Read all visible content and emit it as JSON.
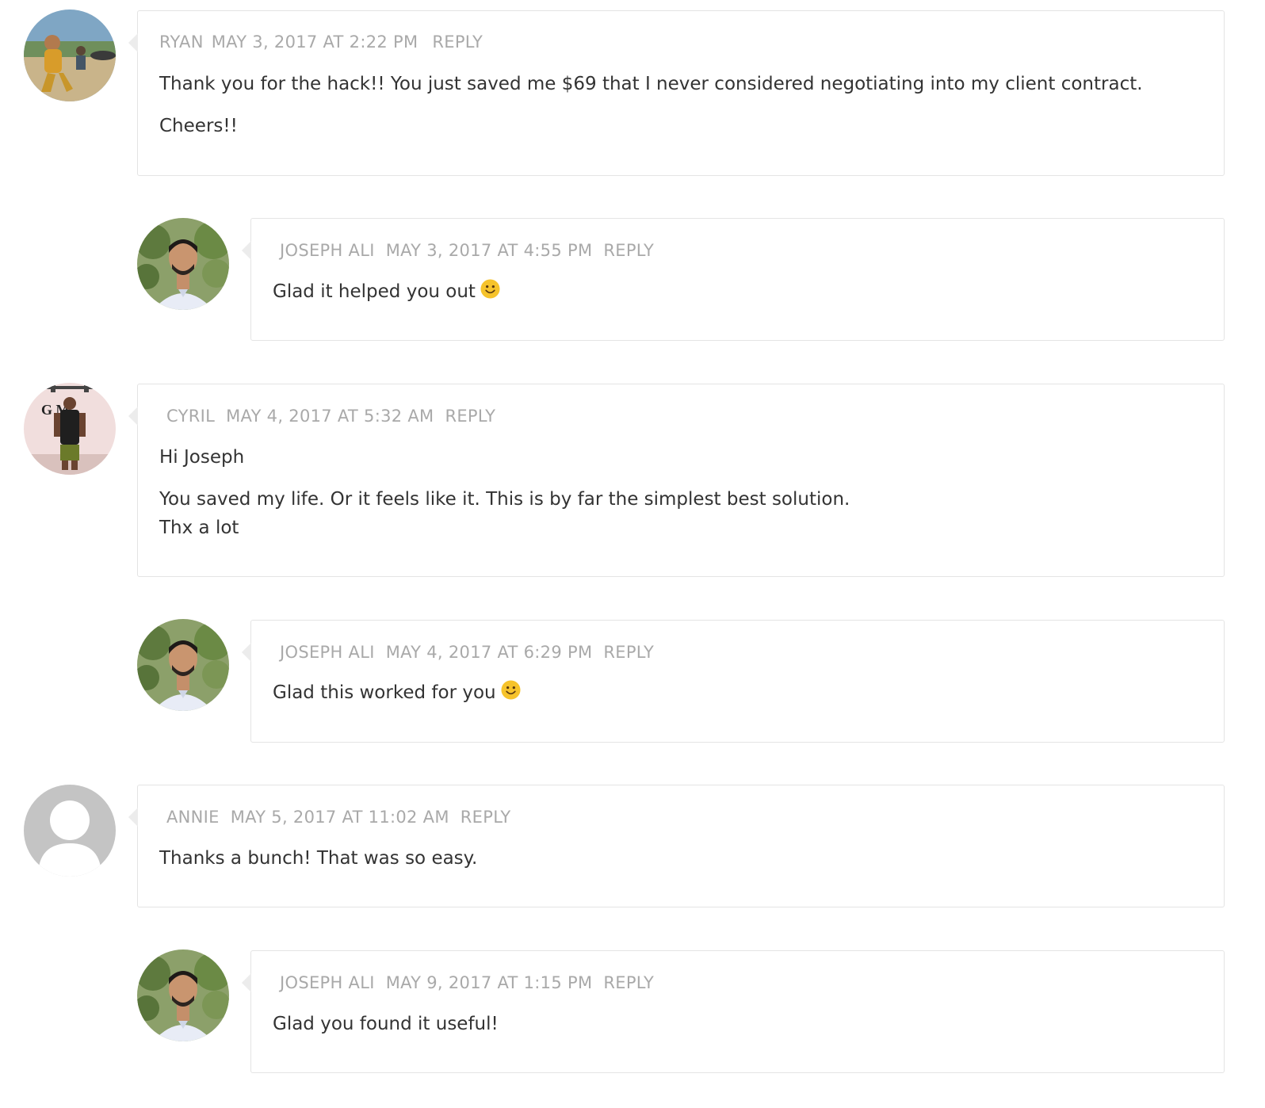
{
  "comments": [
    {
      "author": "RYAN",
      "date": "MAY 3, 2017 AT 2:22 PM",
      "reply": "REPLY",
      "lines": [
        "Thank you for the hack!! You just saved me $69 that I never considered negotiating into my client contract.",
        "Cheers!!"
      ],
      "avatar": "photo-ryan"
    },
    {
      "author": "JOSEPH ALI",
      "date": "MAY 3, 2017 AT 4:55 PM",
      "reply": "REPLY",
      "lines": [
        "Glad it helped you out"
      ],
      "avatar": "photo-joseph",
      "emoji": "smiley-icon"
    },
    {
      "author": "CYRIL",
      "date": "MAY 4, 2017 AT 5:32 AM",
      "reply": "REPLY",
      "lines": [
        "Hi Joseph",
        "You saved my life. Or it feels like it. This is by far the simplest best solution.",
        "Thx a lot"
      ],
      "avatar": "photo-cyril"
    },
    {
      "author": "JOSEPH ALI",
      "date": "MAY 4, 2017 AT 6:29 PM",
      "reply": "REPLY",
      "lines": [
        "Glad this worked for you"
      ],
      "avatar": "photo-joseph",
      "emoji": "smiley-icon"
    },
    {
      "author": "ANNIE",
      "date": "MAY 5, 2017 AT 11:02 AM",
      "reply": "REPLY",
      "lines": [
        "Thanks a bunch! That was so easy."
      ],
      "avatar": "default-user-icon"
    },
    {
      "author": "JOSEPH ALI",
      "date": "MAY 9, 2017 AT 1:15 PM",
      "reply": "REPLY",
      "lines": [
        "Glad you found it useful!"
      ],
      "avatar": "photo-joseph"
    }
  ],
  "colors": {
    "meta_text": "#a9a9a9",
    "body_text": "#333333",
    "border": "#e4e4e4",
    "default_avatar": "#c4c4c4",
    "emoji": "#f6c32b"
  }
}
